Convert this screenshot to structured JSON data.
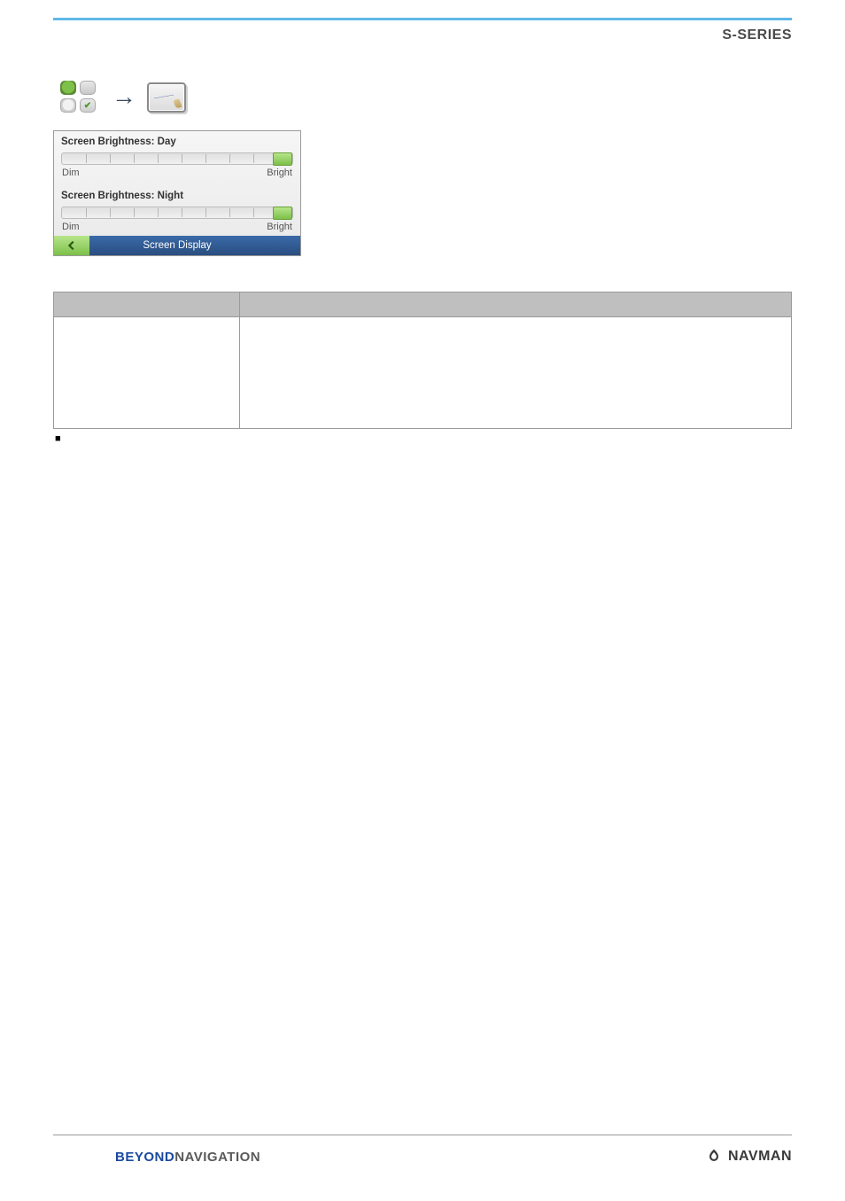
{
  "header": {
    "series_label": "S-SERIES"
  },
  "device": {
    "day_label": "Screen Brightness: Day",
    "night_label": "Screen Brightness: Night",
    "dim": "Dim",
    "bright": "Bright",
    "titlebar": "Screen Display"
  },
  "footer": {
    "beyond_1": "BEYOND",
    "beyond_2": "NAVIGATION",
    "brand": "NAVMAN"
  }
}
